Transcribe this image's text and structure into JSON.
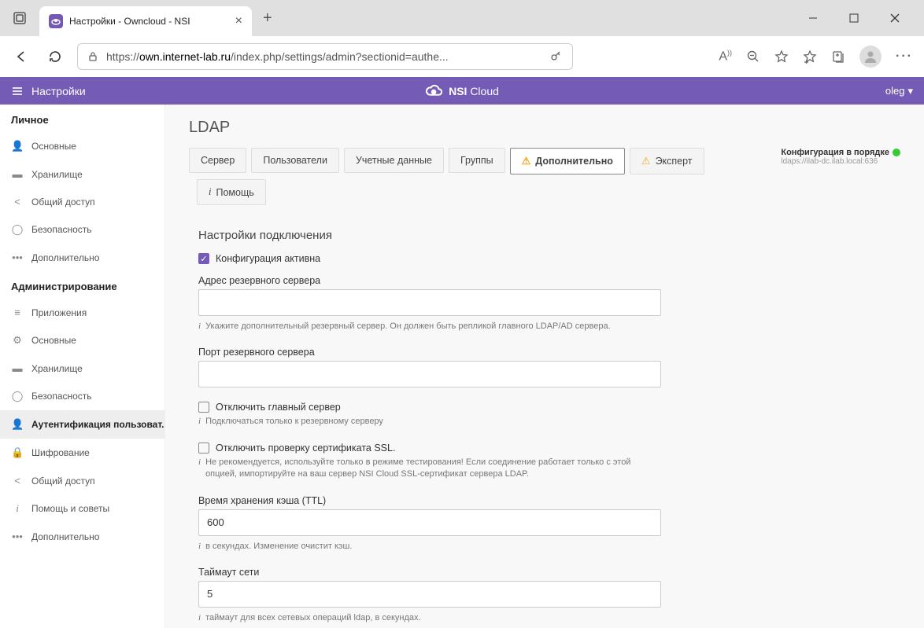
{
  "browser": {
    "tab_title": "Настройки - Owncloud - NSI",
    "url_prefix": "https://",
    "url_strong": "own.internet-lab.ru",
    "url_path": "/index.php/settings/admin?sectionid=authe..."
  },
  "app_header": {
    "title": "Настройки",
    "brand_nsi": "NSI",
    "brand_cloud": "Cloud",
    "user": "oleg"
  },
  "sidebar": {
    "section_personal": "Личное",
    "section_admin": "Администрирование",
    "personal": [
      {
        "label": "Основные"
      },
      {
        "label": "Хранилище"
      },
      {
        "label": "Общий доступ"
      },
      {
        "label": "Безопасность"
      },
      {
        "label": "Дополнительно"
      }
    ],
    "admin": [
      {
        "label": "Приложения"
      },
      {
        "label": "Основные"
      },
      {
        "label": "Хранилище"
      },
      {
        "label": "Безопасность"
      },
      {
        "label": "Аутентификация пользоват..."
      },
      {
        "label": "Шифрование"
      },
      {
        "label": "Общий доступ"
      },
      {
        "label": "Помощь и советы"
      },
      {
        "label": "Дополнительно"
      }
    ]
  },
  "content": {
    "page_title": "LDAP",
    "tabs": {
      "server": "Сервер",
      "users": "Пользователи",
      "credentials": "Учетные данные",
      "groups": "Группы",
      "advanced": "Дополнительно",
      "expert": "Эксперт"
    },
    "config_status": "Конфигурация в порядке",
    "config_server": "ldaps://ilab-dc.ilab.local:636",
    "help": "Помощь",
    "section_title": "Настройки подключения",
    "config_active": "Конфигурация активна",
    "backup_host_label": "Адрес резервного сервера",
    "backup_host_value": "",
    "backup_host_hint": "Укажите дополнительный резервный сервер. Он должен быть репликой главного LDAP/AD сервера.",
    "backup_port_label": "Порт резервного сервера",
    "backup_port_value": "",
    "disable_main": "Отключить главный сервер",
    "disable_main_hint": "Подключаться только к резервному серверу",
    "disable_ssl": "Отключить проверку сертификата SSL.",
    "disable_ssl_hint": "Не рекомендуется, используйте только в режиме тестирования! Если соединение работает только с этой опцией, импортируйте на ваш сервер NSI Cloud SSL-сертификат сервера LDAP.",
    "ttl_label": "Время хранения кэша (TTL)",
    "ttl_value": "600",
    "ttl_hint": "в секундах. Изменение очистит кэш.",
    "timeout_label": "Таймаут сети",
    "timeout_value": "5",
    "timeout_hint": "таймаут для всех сетевых операций ldap, в секундах."
  }
}
